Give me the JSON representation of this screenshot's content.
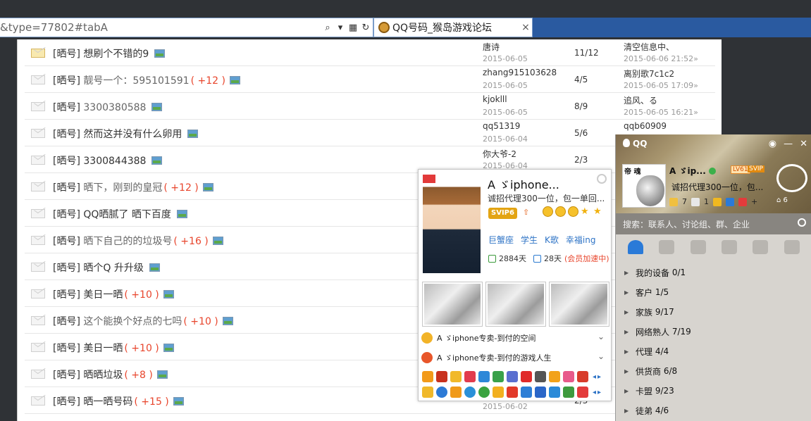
{
  "browser": {
    "address": "&type=77802#tabA",
    "tab_title": "QQ号码_猴岛游戏论坛",
    "close_glyph": "×"
  },
  "threads": [
    {
      "tag": "[晒号]",
      "title": "想刷个不错的9",
      "plus": "",
      "gray": false,
      "author": "唐诗",
      "author_date": "2015-06-05",
      "count": "11/12",
      "last": "清空信息中、",
      "last_date": "2015-06-06 21:52»",
      "hot": true
    },
    {
      "tag": "[晒号]",
      "title": "靓号一个：595101591",
      "plus": "( +12 )",
      "gray": true,
      "author": "zhang915103628",
      "author_date": "2015-06-05",
      "count": "4/5",
      "last": "离别歌7c1c2",
      "last_date": "2015-06-05 17:09»",
      "hot": false
    },
    {
      "tag": "[晒号]",
      "title": "3300380588",
      "plus": "",
      "gray": true,
      "author": "kjoklll",
      "author_date": "2015-06-05",
      "count": "8/9",
      "last": "追风、る",
      "last_date": "2015-06-05 16:21»",
      "hot": false
    },
    {
      "tag": "[晒号]",
      "title": "然而这并没有什么卵用",
      "plus": "",
      "gray": false,
      "author": "qq51319",
      "author_date": "2015-06-04",
      "count": "5/6",
      "last": "qqb60909",
      "last_date": "",
      "hot": false
    },
    {
      "tag": "[晒号]",
      "title": "3300844388",
      "plus": "",
      "gray": false,
      "author": "你大爷-2",
      "author_date": "2015-06-04",
      "count": "2/3",
      "last": "",
      "last_date": "",
      "hot": false
    },
    {
      "tag": "[晒号]",
      "title": "晒下，刚到的皇冠",
      "plus": "( +12 )",
      "gray": true,
      "author": "",
      "author_date": "",
      "count": "",
      "last": "",
      "last_date": "",
      "hot": false
    },
    {
      "tag": "[晒号]",
      "title": "QQ晒腻了  晒下百度",
      "plus": "",
      "gray": false,
      "author": "",
      "author_date": "",
      "count": "",
      "last": "",
      "last_date": "",
      "hot": false
    },
    {
      "tag": "[晒号]",
      "title": "晒下自己的的垃圾号",
      "plus": "( +16 )",
      "gray": true,
      "author": "",
      "author_date": "",
      "count": "",
      "last": "",
      "last_date": "",
      "hot": false
    },
    {
      "tag": "[晒号]",
      "title": "晒个Q 升升级",
      "plus": "",
      "gray": false,
      "author": "",
      "author_date": "",
      "count": "",
      "last": "",
      "last_date": "",
      "hot": false
    },
    {
      "tag": "[晒号]",
      "title": "美日一晒",
      "plus": "( +10 )",
      "gray": false,
      "author": "",
      "author_date": "",
      "count": "",
      "last": "",
      "last_date": "",
      "hot": false
    },
    {
      "tag": "[晒号]",
      "title": "这个能换个好点的七吗",
      "plus": "( +10 )",
      "gray": true,
      "author": "",
      "author_date": "",
      "count": "",
      "last": "",
      "last_date": "",
      "hot": false
    },
    {
      "tag": "[晒号]",
      "title": "美日一晒",
      "plus": "( +10 )",
      "gray": false,
      "author": "",
      "author_date": "",
      "count": "",
      "last": "",
      "last_date": "",
      "hot": false
    },
    {
      "tag": "[晒号]",
      "title": "晒晒垃圾",
      "plus": "( +8 )",
      "gray": false,
      "author": "",
      "author_date": "",
      "count": "",
      "last": "",
      "last_date": "",
      "hot": false
    },
    {
      "tag": "[晒号]",
      "title": "晒一晒号码",
      "plus": "( +15 )",
      "gray": false,
      "author": "",
      "author_date": "2015-06-02",
      "count": "2/3",
      "last": "",
      "last_date": "",
      "hot": false
    }
  ],
  "card": {
    "name": "A ゞiphone...",
    "sign": "诚招代理300一位，包一单回...",
    "vip": "SVIP6",
    "tags": [
      "巨蟹座",
      "学生",
      "K歌",
      "幸福ing"
    ],
    "days": "2884天",
    "days2": "28天",
    "accel": "(会员加速中)",
    "space1": "A ゞiphone专卖-到付的空间",
    "space2": "A ゞiphone专卖-到付的游戏人生"
  },
  "qq": {
    "logo": "QQ",
    "avatar_text": "帝 魂",
    "name": "A ゞip...",
    "level": "LV61",
    "svip": "SVIP",
    "sign": "诚招代理300一位，包...",
    "mini_counts": [
      "7",
      "1"
    ],
    "weather_text": "6",
    "search_placeholder": "搜索：联系人、讨论组、群、企业",
    "groups": [
      {
        "name": "我的设备",
        "count": "0/1"
      },
      {
        "name": "客户",
        "count": "1/5"
      },
      {
        "name": "家族",
        "count": "9/17"
      },
      {
        "name": "网络熟人",
        "count": "7/19"
      },
      {
        "name": "代理",
        "count": "4/4"
      },
      {
        "name": "供货商",
        "count": "6/8"
      },
      {
        "name": "卡盟",
        "count": "9/23"
      },
      {
        "name": "徒弟",
        "count": "4/6"
      }
    ]
  }
}
